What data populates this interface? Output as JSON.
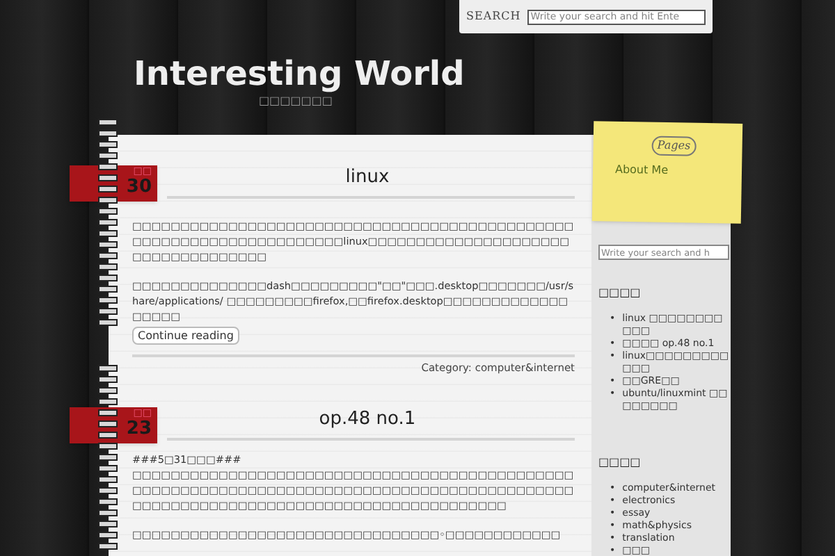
{
  "header": {
    "search_label": "SEARCH",
    "search_placeholder": "Write your search and hit Ente"
  },
  "site": {
    "title": "Interesting World",
    "tagline": "□□□□□□□"
  },
  "posts": [
    {
      "month": "□□",
      "day": "30",
      "title": "linux",
      "paragraphs": [
        "□□□□□□□□□□□□□□□□□□□□□□□□□□□□□□□□□□□□□□□□□□□□□□□□□□□□□□□□□□□□□□□□□□□□linux□□□□□□□□□□□□□□□□□□□□□□□□□□□□□□□□□□□",
        "□□□□□□□□□□□□□□dash□□□□□□□□□\"□□\"□□□.desktop□□□□□□□/usr/share/applications/ □□□□□□□□□firefox,□□firefox.desktop□□□□□□□□□□□□□□□□□□"
      ],
      "button": "Continue reading",
      "category": "Category: computer&internet"
    },
    {
      "month": "□□",
      "day": "23",
      "title": "op.48 no.1",
      "heading_line": "###5□31□□□###",
      "paragraphs": [
        "□□□□□□□□□□□□□□□□□□□□□□□□□□□□□□□□□□□□□□□□□□□□□□□□□□□□□□□□□□□□□□□□□□□□□□□□□□□□□□□□□□□□□□□□□□□□□□□□□□□□□□□□□□□□□□□□□□□□□□□□□□□□□□□□□□□",
        "□□□□□□□□□□□□□□□□□□□□□□□□□□□□□□□□◦□□□□□□□□□□□□"
      ]
    }
  ],
  "sidebar": {
    "pages_title": "Pages",
    "pages": [
      "About Me"
    ],
    "search_placeholder": "Write your search and h",
    "sections": [
      {
        "title": "□□□□",
        "marker": "•",
        "items": [
          "linux □□□□□□□□□□□",
          "□□□□ op.48 no.1",
          "linux□□□□□□□□□□□□",
          "□□GRE□□",
          "ubuntu/linuxmint □□□□□□□□"
        ]
      },
      {
        "title": "□□□□",
        "marker": "•",
        "items": [
          "computer&internet",
          "electronics",
          "essay",
          "math&physics",
          "translation",
          "□□□"
        ]
      }
    ]
  }
}
